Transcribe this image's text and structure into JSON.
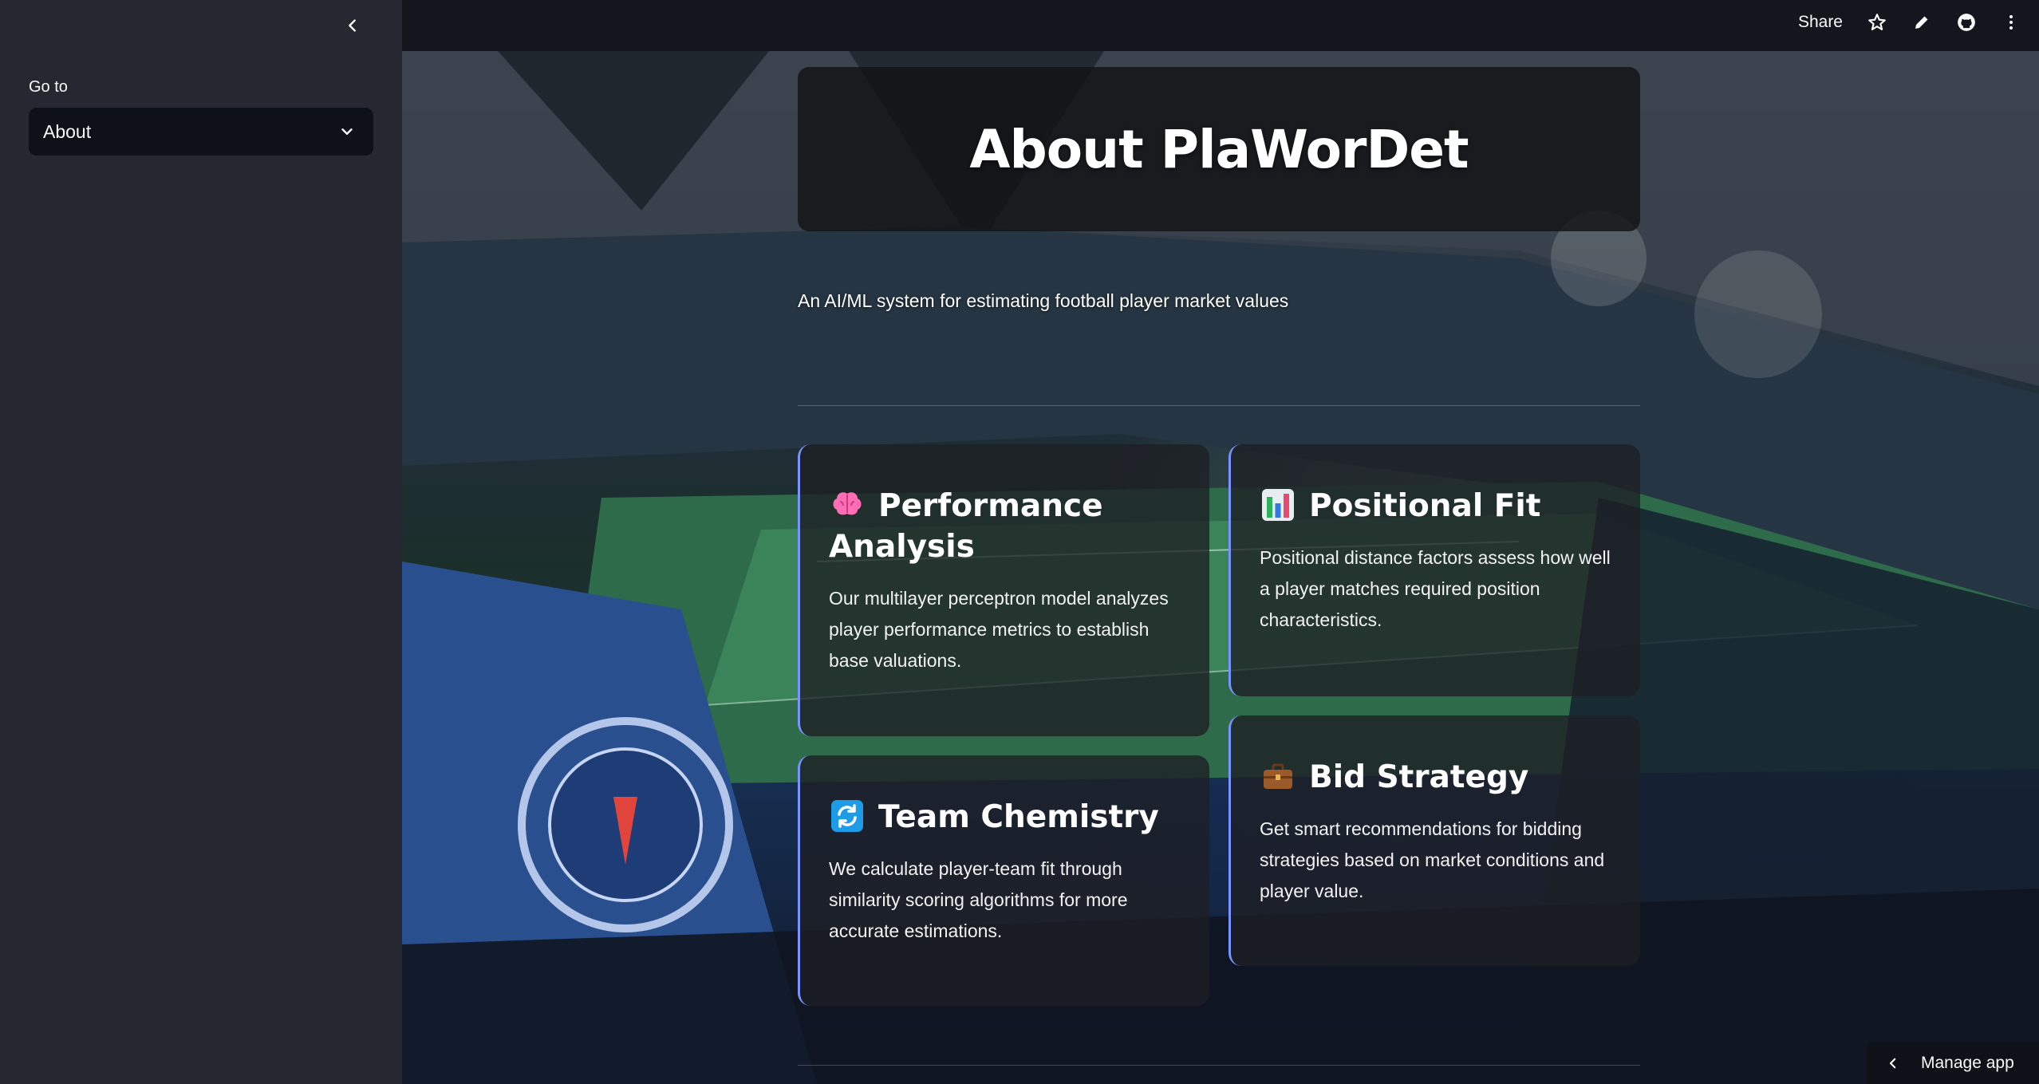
{
  "sidebar": {
    "nav_label": "Go to",
    "nav_selected": "About"
  },
  "header": {
    "share_label": "Share"
  },
  "main": {
    "title": "About PlaWorDet",
    "subtitle": "An AI/ML system for estimating football player market values",
    "cards": [
      {
        "icon": "brain-icon",
        "title": "Performance Analysis",
        "text": "Our multilayer perceptron model analyzes player performance metrics to establish base valuations."
      },
      {
        "icon": "bar-chart-icon",
        "title": "Positional Fit",
        "text": "Positional distance factors assess how well a player matches required position characteristics."
      },
      {
        "icon": "refresh-icon",
        "title": "Team Chemistry",
        "text": "We calculate player-team fit through similarity scoring algorithms for more accurate estimations."
      },
      {
        "icon": "briefcase-icon",
        "title": "Bid Strategy",
        "text": "Get smart recommendations for bidding strategies based on market conditions and player value."
      }
    ]
  },
  "footer": {
    "manage_app_label": "Manage app"
  },
  "colors": {
    "sidebar_bg": "#262730",
    "header_bg": "#15161d",
    "card_accent": "#7b93ff",
    "brain_icon": "#ff6eb4",
    "refresh_icon": "#1e9be6",
    "briefcase_icon": "#9a5a2a"
  }
}
